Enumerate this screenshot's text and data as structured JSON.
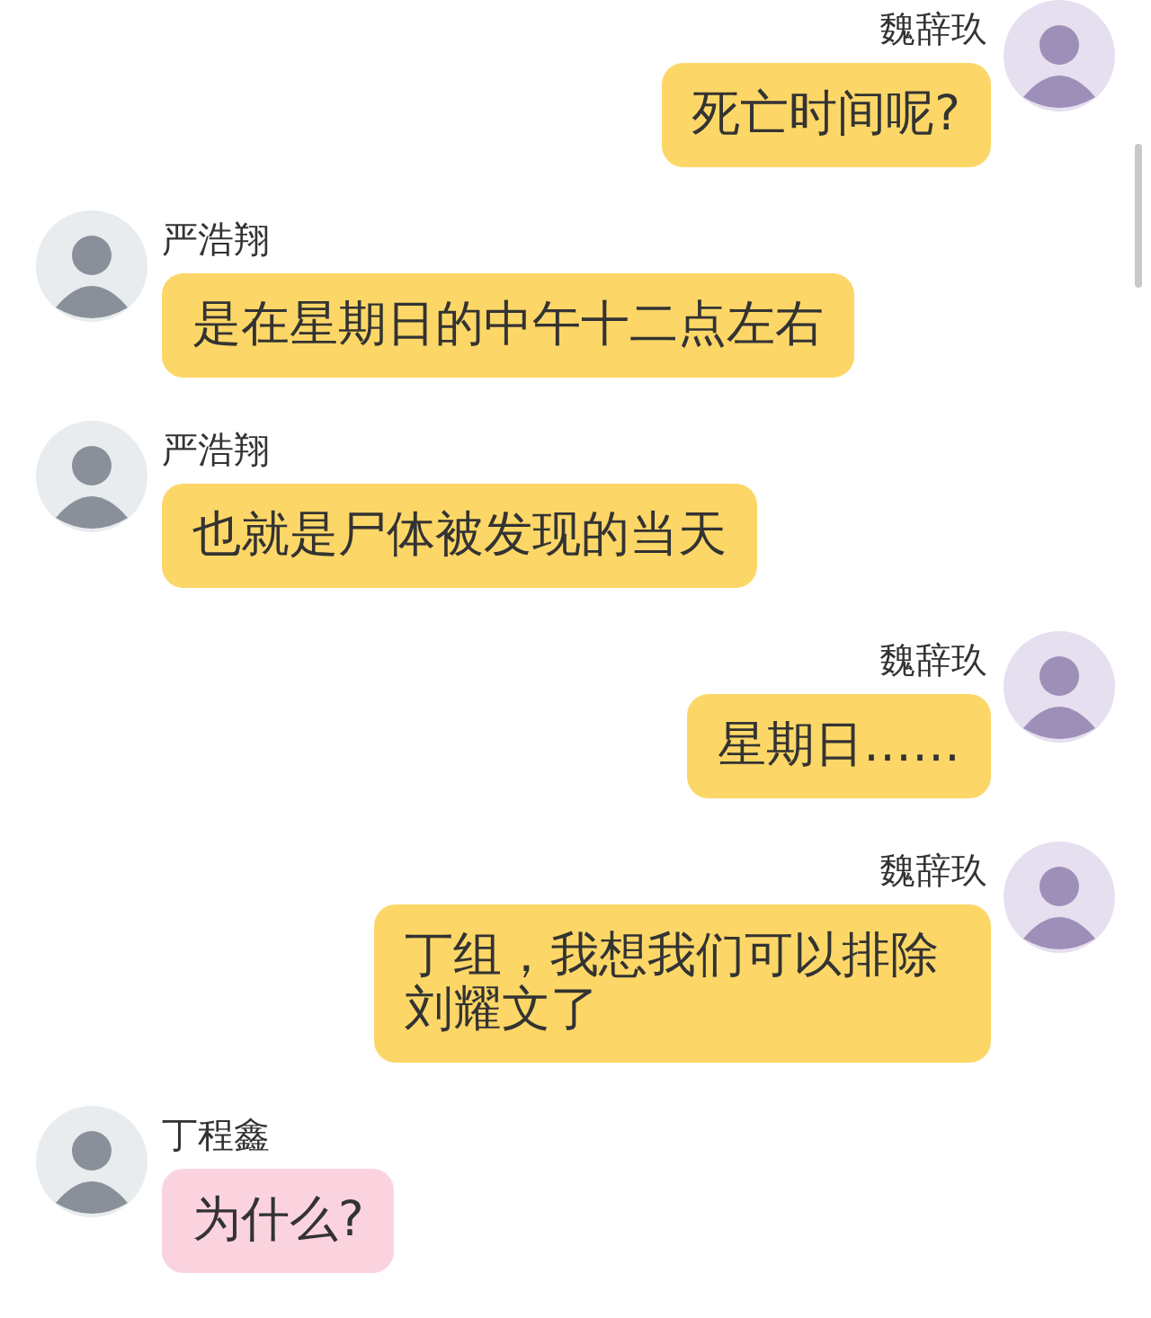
{
  "messages": [
    {
      "kind": "sent",
      "sender": "魏辞玖",
      "text": "死亡时间呢?",
      "color": "#fcd767"
    },
    {
      "kind": "received",
      "sender": "严浩翔",
      "text": "是在星期日的中午十二点左右",
      "color": "#fcd767"
    },
    {
      "kind": "received",
      "sender": "严浩翔",
      "text": "也就是尸体被发现的当天",
      "color": "#fcd767"
    },
    {
      "kind": "sent",
      "sender": "魏辞玖",
      "text": "星期日……",
      "color": "#fcd767"
    },
    {
      "kind": "sent",
      "sender": "魏辞玖",
      "text": "丁组，我想我们可以排除刘耀文了",
      "color": "#fcd767"
    },
    {
      "kind": "received",
      "sender": "丁程鑫",
      "text": "为什么?",
      "color": "#fbd3df"
    }
  ]
}
